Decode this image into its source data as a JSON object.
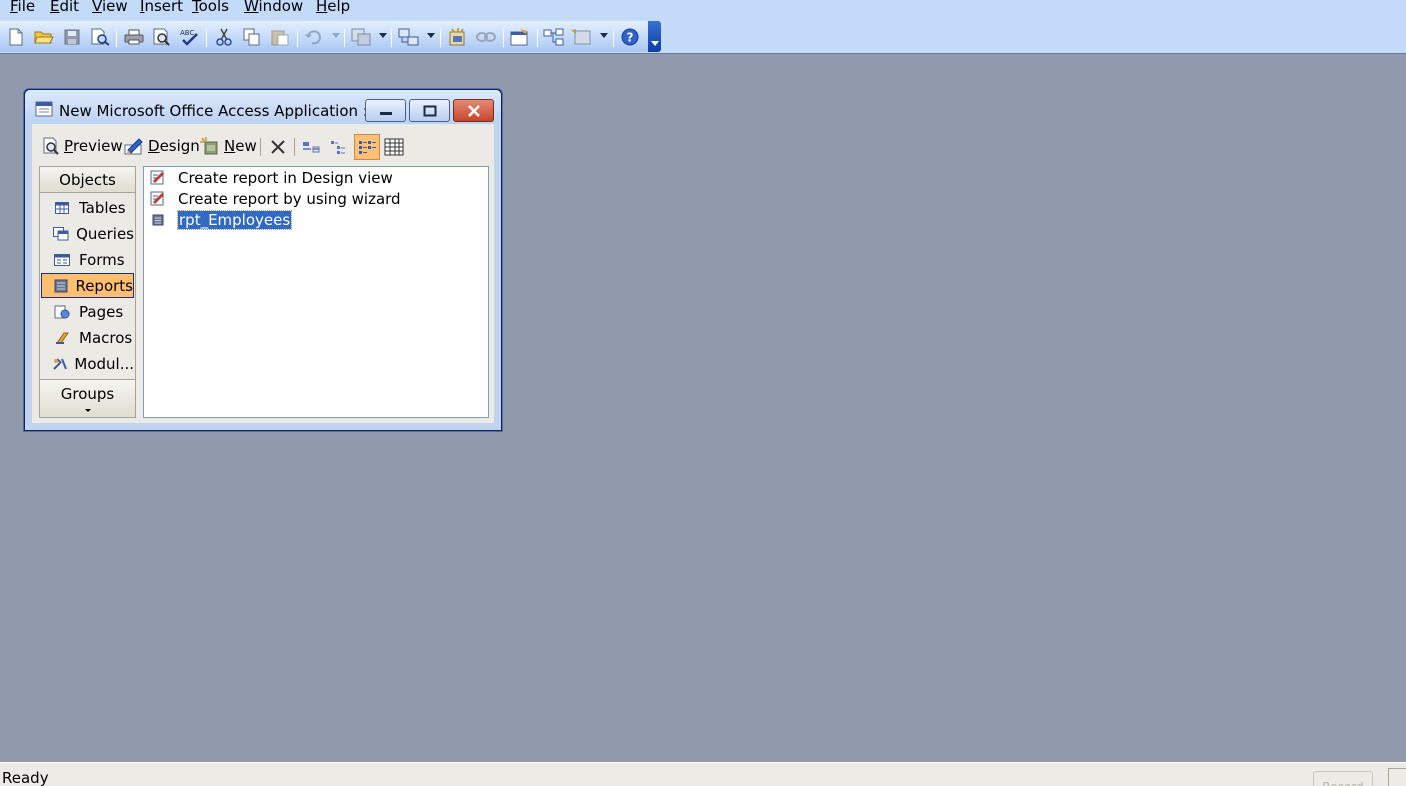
{
  "menubar": {
    "items": [
      {
        "first": "F",
        "rest": "ile"
      },
      {
        "first": "E",
        "rest": "dit"
      },
      {
        "first": "V",
        "rest": "iew"
      },
      {
        "first": "I",
        "rest": "nsert"
      },
      {
        "first": "T",
        "rest": "ools"
      },
      {
        "first": "W",
        "rest": "indow"
      },
      {
        "first": "H",
        "rest": "elp"
      }
    ]
  },
  "toolbar": {
    "icons": [
      "new-icon",
      "open-icon",
      "save-icon",
      "file-search-icon",
      "print-icon",
      "print-preview-icon",
      "spelling-icon",
      "cut-icon",
      "copy-icon",
      "paste-icon",
      "undo-icon",
      "office-links-icon",
      "analyze-icon",
      "code-icon",
      "script-editor-icon",
      "properties-icon",
      "relationships-icon",
      "new-object-icon",
      "help-icon"
    ]
  },
  "dbwindow": {
    "title": "New Microsoft Office Access Application : D...",
    "toolbar": {
      "preview": {
        "first": "P",
        "rest": "review"
      },
      "design": {
        "first": "D",
        "rest": "esign"
      },
      "new": {
        "first": "N",
        "rest": "ew"
      }
    },
    "objects_header": "Objects",
    "objects": [
      "Tables",
      "Queries",
      "Forms",
      "Reports",
      "Pages",
      "Macros",
      "Modul..."
    ],
    "active_object": "Reports",
    "groups_header": "Groups",
    "list_items": [
      "Create report in Design view",
      "Create report by using wizard",
      "rpt_Employees"
    ],
    "selected_item": "rpt_Employees"
  },
  "statusbar": {
    "text": "Ready",
    "record_indicator": "Record"
  },
  "colors": {
    "workspace": "#9199ac",
    "toolbar": "#c3daf9",
    "selection": "#316ac5",
    "active_object": "#ffbf6f"
  }
}
